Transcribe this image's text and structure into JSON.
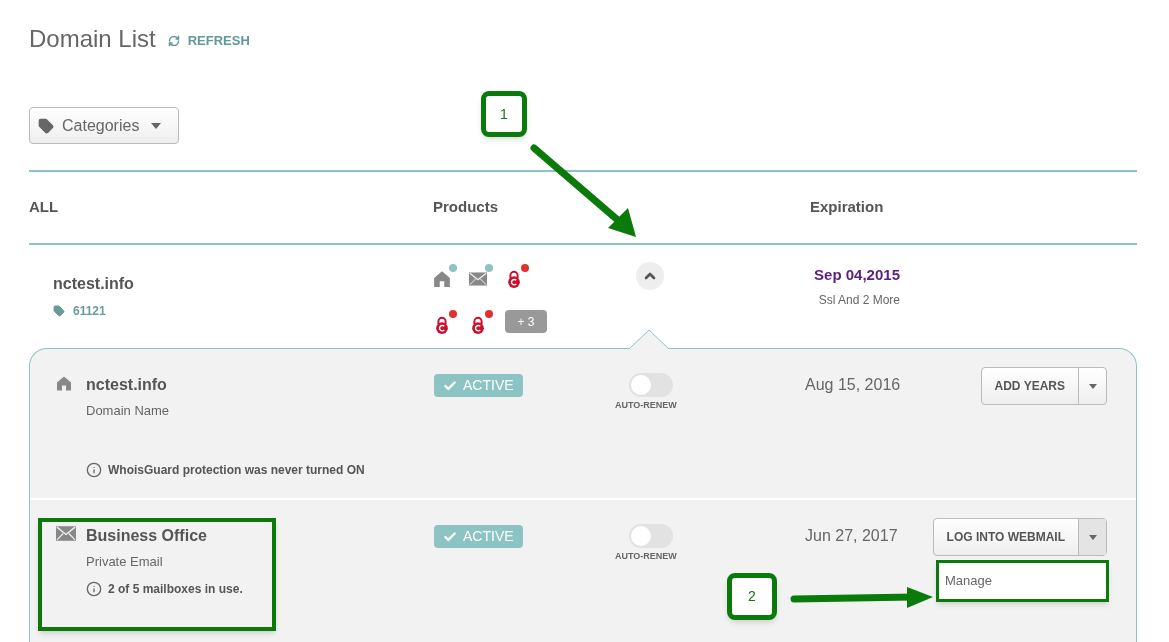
{
  "page": {
    "title": "Domain List",
    "refresh": "REFRESH"
  },
  "categories_button": "Categories",
  "columns": [
    "ALL",
    "Products",
    "Expiration"
  ],
  "domain": {
    "name": "nctest.info",
    "tag": "61121",
    "expanded": true,
    "expiration": "Sep 04,2015",
    "expiration_note": "Ssl And 2 More",
    "more": "+ 3",
    "products": [
      {
        "kind": "domain",
        "color": "#8cc3c3"
      },
      {
        "kind": "email",
        "color": "#8cc3c3"
      },
      {
        "kind": "ssl",
        "color": "#e0312f"
      },
      {
        "kind": "ssl",
        "color": "#e0312f"
      },
      {
        "kind": "ssl",
        "color": "#e0312f"
      }
    ]
  },
  "products": [
    {
      "kind": "domain",
      "name": "nctest.info",
      "type": "Domain Name",
      "status": "ACTIVE",
      "auto_renew": false,
      "auto_renew_label": "AUTO-RENEW",
      "date": "Aug 15, 2016",
      "action": "ADD YEARS",
      "note": "WhoisGuard protection was never turned ON",
      "menu_open": false
    },
    {
      "kind": "email",
      "name": "Business Office",
      "type": "Private Email",
      "status": "ACTIVE",
      "auto_renew": false,
      "auto_renew_label": "AUTO-RENEW",
      "date": "Jun 27, 2017",
      "action": "LOG INTO WEBMAIL",
      "note": "2 of 5 mailboxes in use.",
      "menu_open": true,
      "menu": [
        "Manage"
      ]
    }
  ],
  "annotations": [
    {
      "label": "1"
    },
    {
      "label": "2"
    }
  ]
}
